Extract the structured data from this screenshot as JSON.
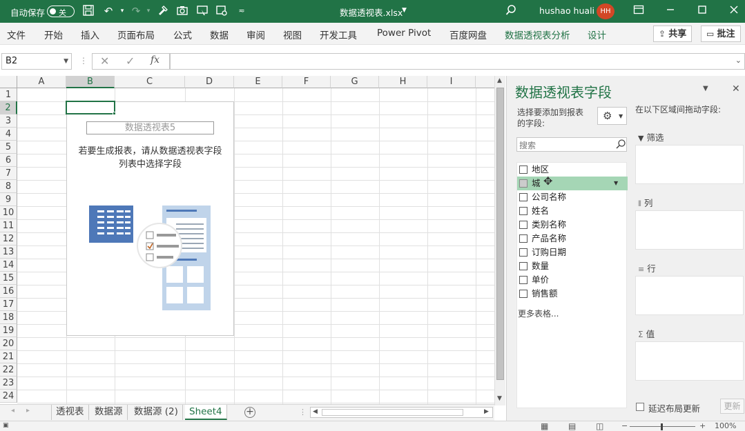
{
  "titlebar": {
    "autosave_label": "自动保存",
    "autosave_state": "关",
    "filename": "数据透视表.xlsx",
    "user_name": "hushao huali",
    "user_initials": "HH"
  },
  "ribbon": {
    "tabs": [
      "文件",
      "开始",
      "插入",
      "页面布局",
      "公式",
      "数据",
      "审阅",
      "视图",
      "开发工具",
      "Power Pivot",
      "百度网盘",
      "数据透视表分析",
      "设计"
    ],
    "active_tab": "数据透视表分析",
    "share_label": "共享",
    "comment_label": "批注"
  },
  "formula_bar": {
    "name_box": "B2",
    "fx_label": "fx",
    "value": ""
  },
  "grid": {
    "columns": [
      "A",
      "B",
      "C",
      "D",
      "E",
      "F",
      "G",
      "H",
      "I"
    ],
    "selected_column": "B",
    "rows": [
      "1",
      "2",
      "3",
      "4",
      "5",
      "6",
      "7",
      "8",
      "9",
      "10",
      "11",
      "12",
      "13",
      "14",
      "15",
      "16",
      "17",
      "18",
      "19",
      "20",
      "21",
      "22",
      "23",
      "24"
    ],
    "selected_row": "2",
    "selected_cell": "B2"
  },
  "pivot_placeholder": {
    "name": "数据透视表5",
    "instruction_line1": "若要生成报表，请从数据透视表字段",
    "instruction_line2": "列表中选择字段"
  },
  "sheets": {
    "tabs": [
      "透视表",
      "数据源",
      "数据源 (2)",
      "Sheet4"
    ],
    "active": "Sheet4"
  },
  "panel": {
    "title": "数据透视表字段",
    "choose_fields_line1": "选择要添加到报表",
    "choose_fields_line2": "的字段:",
    "search_placeholder": "搜索",
    "fields": [
      "地区",
      "城市",
      "公司名称",
      "姓名",
      "类别名称",
      "产品名称",
      "订购日期",
      "数量",
      "单价",
      "销售额"
    ],
    "dragging_field": "城市",
    "dragging_field_visible_text": "城",
    "more_tables": "更多表格...",
    "drag_hint": "在以下区域间拖动字段:",
    "areas": {
      "filter": "筛选",
      "columns": "列",
      "rows": "行",
      "values": "值"
    },
    "defer_label": "延迟布局更新",
    "update_label": "更新"
  },
  "statusbar": {
    "zoom": "100%"
  },
  "colors": {
    "accent": "#217346",
    "drag_highlight": "#a5d6b5"
  }
}
